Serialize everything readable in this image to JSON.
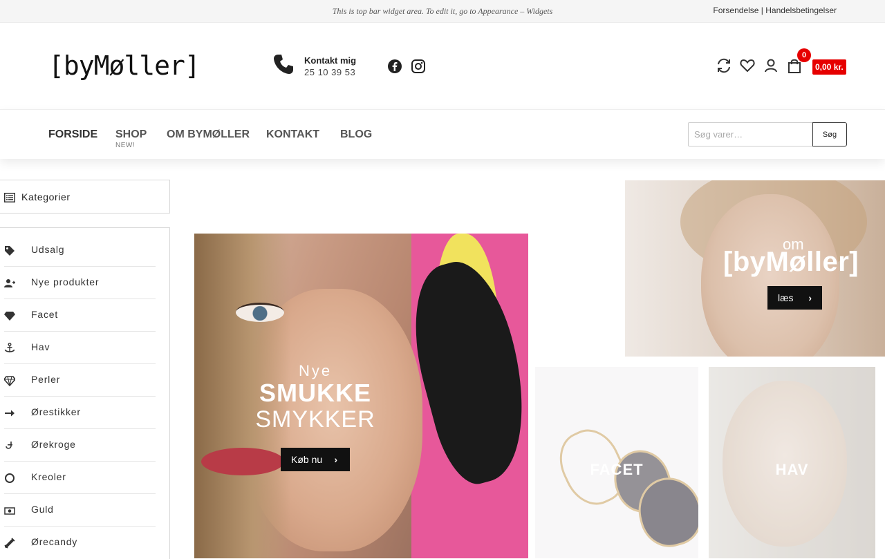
{
  "topbar": {
    "widget_text": "This is top bar widget area. To edit it, go to Appearance – Widgets",
    "links": [
      "Forsendelse",
      "Handelsbetingelser"
    ],
    "separator": " | "
  },
  "header": {
    "logo": "[byMøller]",
    "contact_title": "Kontakt mig",
    "contact_phone": "25 10 39 53",
    "social": [
      "facebook-icon",
      "instagram-icon"
    ],
    "icons": [
      "refresh-icon",
      "heart-icon",
      "user-icon",
      "bag-icon"
    ],
    "cart_count": "0",
    "cart_total": "0,00 kr.",
    "accent_color": "#e60000"
  },
  "nav": {
    "items": [
      {
        "label": "FORSIDE"
      },
      {
        "label": "SHOP",
        "sub": "NEW!"
      },
      {
        "label": "OM BYMØLLER"
      },
      {
        "label": "KONTAKT"
      },
      {
        "label": "BLOG"
      }
    ],
    "search_placeholder": "Søg varer…",
    "search_button": "Søg"
  },
  "sidebar": {
    "heading": "Kategorier",
    "items": [
      {
        "label": "Udsalg",
        "icon": "tag-icon"
      },
      {
        "label": "Nye produkter",
        "icon": "user-plus-icon"
      },
      {
        "label": "Facet",
        "icon": "gem-icon"
      },
      {
        "label": "Hav",
        "icon": "anchor-icon"
      },
      {
        "label": "Perler",
        "icon": "diamond-icon"
      },
      {
        "label": "Ørestikker",
        "icon": "arrow-right-icon"
      },
      {
        "label": "Ørekroge",
        "icon": "hook-icon"
      },
      {
        "label": "Kreoler",
        "icon": "circle-icon"
      },
      {
        "label": "Guld",
        "icon": "money-icon"
      },
      {
        "label": "Ørecandy",
        "icon": "candy-icon"
      }
    ]
  },
  "banners": {
    "main": {
      "line1": "Nye",
      "line2": "SMUKKE",
      "line3": "SMYKKER",
      "button": "Køb nu"
    },
    "about": {
      "small": "om",
      "brand": "[byMøller]",
      "button": "læs"
    },
    "tiles": [
      {
        "title": "FACET"
      },
      {
        "title": "HAV"
      }
    ]
  }
}
